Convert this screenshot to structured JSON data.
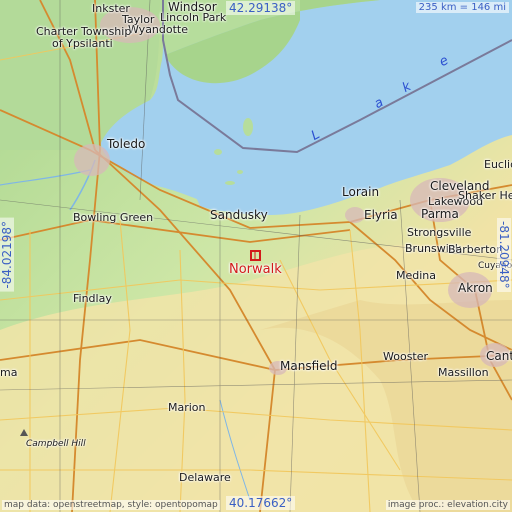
{
  "map": {
    "coords": {
      "north": "42.29138°",
      "south": "40.17662°",
      "west": "-84.02198°",
      "east": "-81.20948°"
    },
    "scale": "235 km = 146 mi",
    "attribution_left": "map data: openstreetmap, style: opentopomap",
    "attribution_right": "image proc.: elevation.city",
    "highlighted_city": "Norwalk",
    "lake_letters": [
      "L",
      "a",
      "k",
      "e"
    ],
    "colors": {
      "water": "#a2d0ee",
      "lowland": "#b7dc9e",
      "upland": "#f1e4a8",
      "highlight": "#d21a1a",
      "coord_text": "#3a5fc4"
    },
    "places": [
      {
        "id": "wyandotte",
        "name": "Wyandotte"
      },
      {
        "id": "inkster",
        "name": "Inkster"
      },
      {
        "id": "windsor",
        "name": "Windsor"
      },
      {
        "id": "lincoln-park",
        "name": "Lincoln Park"
      },
      {
        "id": "charter-township",
        "name": "Charter Township"
      },
      {
        "id": "of-ypsilanti",
        "name": "of Ypsilanti"
      },
      {
        "id": "taylor",
        "name": "Taylor"
      },
      {
        "id": "toledo",
        "name": "Toledo"
      },
      {
        "id": "bowling-green",
        "name": "Bowling Green"
      },
      {
        "id": "findlay",
        "name": "Findlay"
      },
      {
        "id": "sandusky",
        "name": "Sandusky"
      },
      {
        "id": "lorain",
        "name": "Lorain"
      },
      {
        "id": "elyria",
        "name": "Elyria"
      },
      {
        "id": "cleveland",
        "name": "Cleveland"
      },
      {
        "id": "euclid",
        "name": "Euclid"
      },
      {
        "id": "lakewood",
        "name": "Lakewood"
      },
      {
        "id": "parma",
        "name": "Parma"
      },
      {
        "id": "shaker-heigh",
        "name": "Shaker Heigh"
      },
      {
        "id": "strongsville",
        "name": "Strongsville"
      },
      {
        "id": "brunswick",
        "name": "Brunswick"
      },
      {
        "id": "medina",
        "name": "Medina"
      },
      {
        "id": "barberton",
        "name": "Barberton"
      },
      {
        "id": "akron",
        "name": "Akron"
      },
      {
        "id": "cuyahog",
        "name": "Cuyahog"
      },
      {
        "id": "mansfield",
        "name": "Mansfield"
      },
      {
        "id": "wooster",
        "name": "Wooster"
      },
      {
        "id": "massillon",
        "name": "Massillon"
      },
      {
        "id": "cant",
        "name": "Cant"
      },
      {
        "id": "marion",
        "name": "Marion"
      },
      {
        "id": "delaware",
        "name": "Delaware"
      },
      {
        "id": "campbell-hill",
        "name": "Campbell Hill"
      },
      {
        "id": "ima",
        "name": "ma"
      }
    ]
  }
}
